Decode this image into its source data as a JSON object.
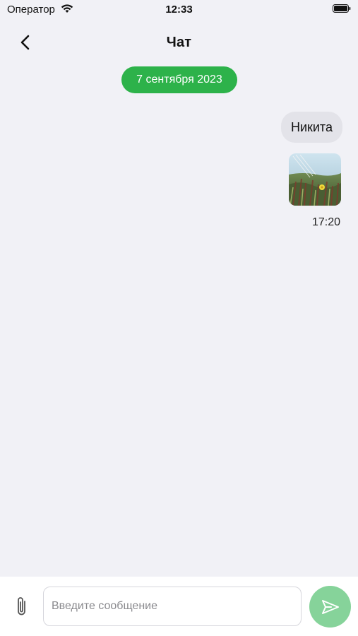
{
  "status_bar": {
    "carrier": "Оператор",
    "time": "12:33",
    "wifi_icon": "wifi-icon",
    "battery_icon": "battery-icon"
  },
  "nav": {
    "back_icon": "chevron-left-icon",
    "title": "Чат"
  },
  "chat": {
    "date_label": "7 сентября 2023",
    "date_color": "#2db24a",
    "messages": [
      {
        "type": "text",
        "text": "Никита"
      },
      {
        "type": "image",
        "description_icon": "photo-thumbnail"
      }
    ],
    "last_time": "17:20"
  },
  "composer": {
    "attach_icon": "paperclip-icon",
    "placeholder": "Введите сообщение",
    "value": "",
    "send_icon": "send-icon",
    "send_color": "#86d39a"
  }
}
